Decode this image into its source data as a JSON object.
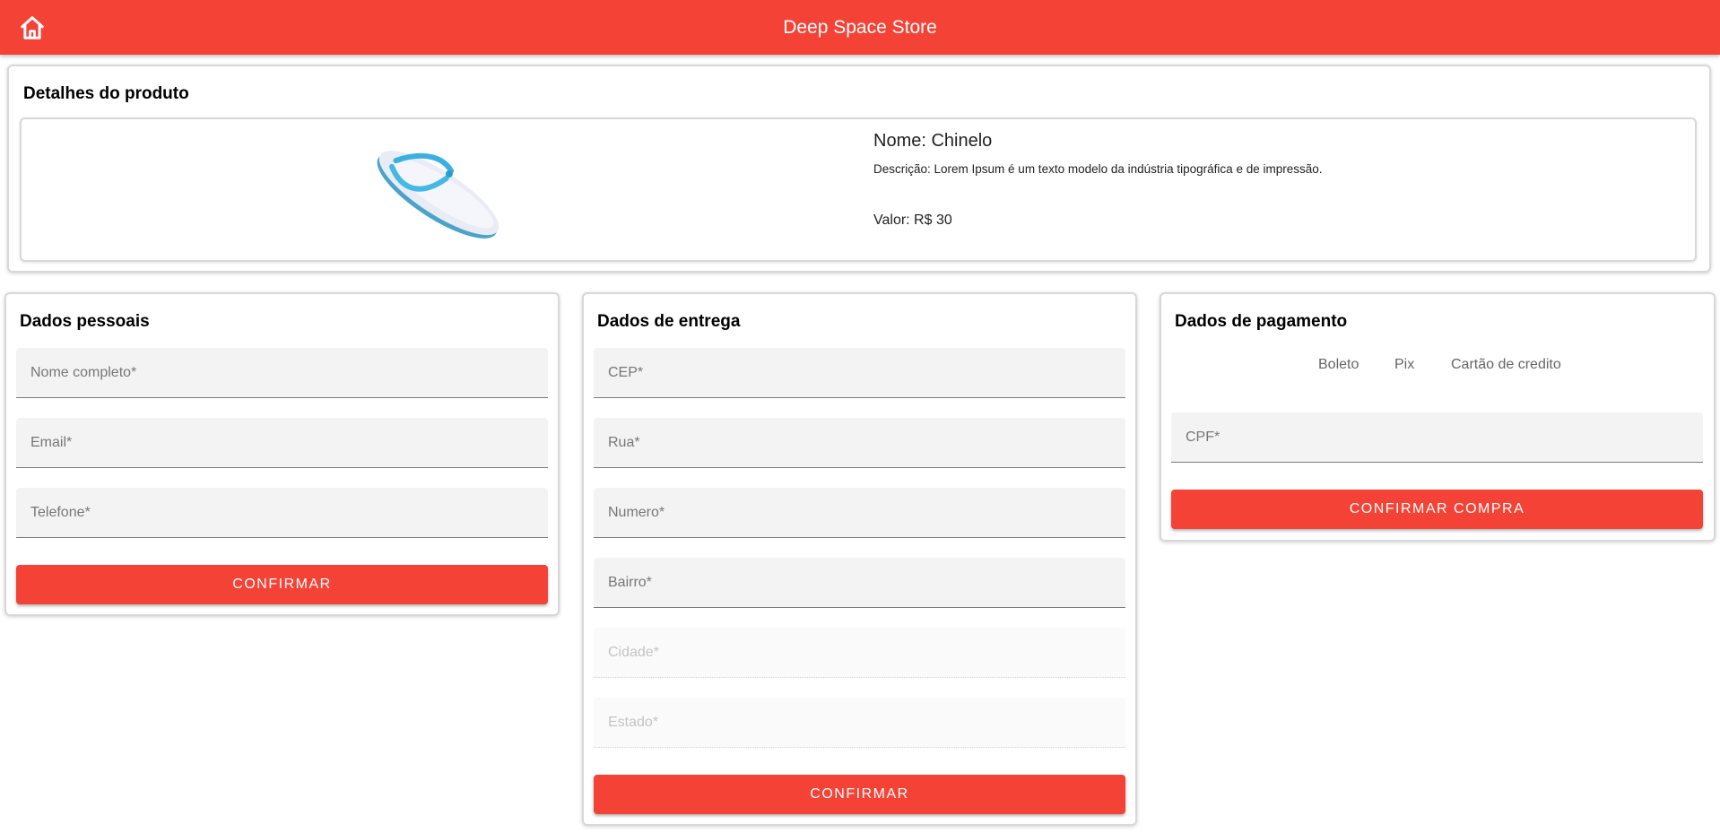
{
  "header": {
    "title": "Deep Space Store",
    "home_icon": "home-icon",
    "color": "#f44336"
  },
  "product": {
    "section_title": "Detalhes do produto",
    "name": "Nome: Chinelo",
    "description": "Descrição: Lorem Ipsum é um texto modelo da indústria tipográfica e de impressão.",
    "price": "Valor: R$ 30",
    "image_icon": "flip-flop-image"
  },
  "personal": {
    "title": "Dados pessoais",
    "fields": {
      "full_name": "Nome completo*",
      "email": "Email*",
      "phone": "Telefone*"
    },
    "confirm_label": "CONFIRMAR"
  },
  "delivery": {
    "title": "Dados de entrega",
    "fields": {
      "cep": "CEP*",
      "street": "Rua*",
      "number": "Numero*",
      "district": "Bairro*",
      "city": "Cidade*",
      "state": "Estado*"
    },
    "confirm_label": "CONFIRMAR"
  },
  "payment": {
    "title": "Dados de pagamento",
    "options": {
      "boleto": "Boleto",
      "pix": "Pix",
      "card": "Cartão de credito"
    },
    "fields": {
      "cpf": "CPF*"
    },
    "confirm_label": "CONFIRMAR COMPRA"
  }
}
